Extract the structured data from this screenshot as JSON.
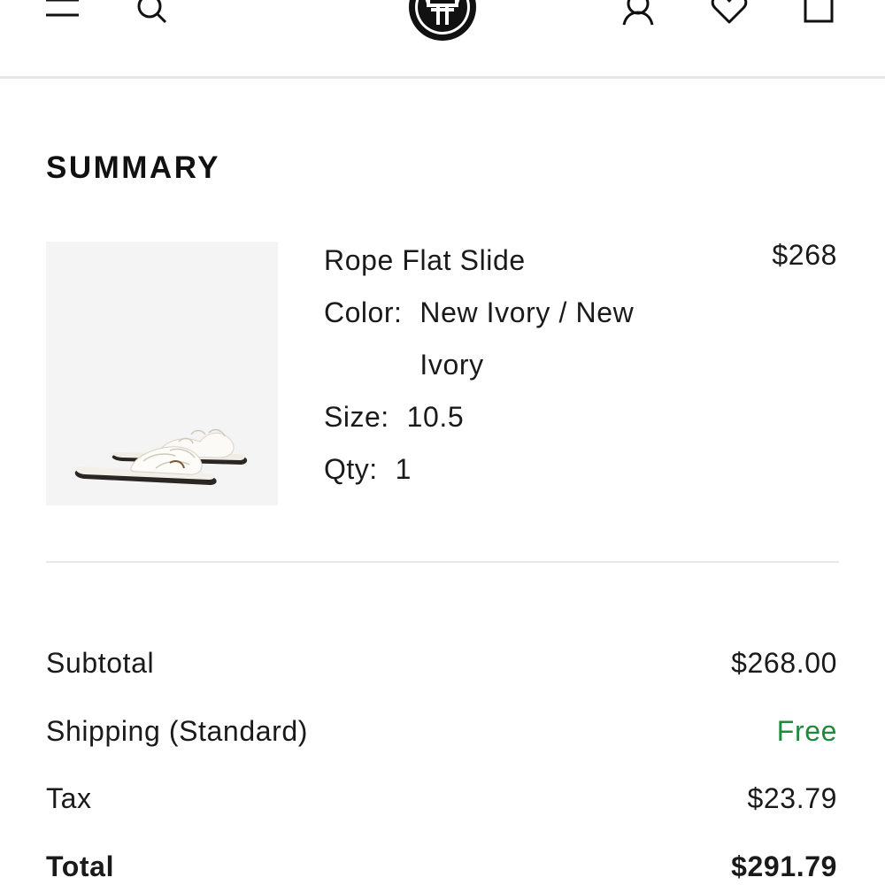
{
  "header": {
    "icons": {
      "menu": "menu-icon",
      "search": "search-icon",
      "logo": "brand-logo",
      "account": "account-icon",
      "wishlist": "heart-icon",
      "bag": "bag-icon"
    }
  },
  "summary": {
    "title": "SUMMARY",
    "item": {
      "name": "Rope Flat Slide",
      "price": "$268",
      "color_label": "Color:",
      "color_value": "New Ivory / New Ivory",
      "size_label": "Size:",
      "size_value": "10.5",
      "qty_label": "Qty:",
      "qty_value": "1"
    }
  },
  "totals": {
    "subtotal_label": "Subtotal",
    "subtotal_value": "$268.00",
    "shipping_label": "Shipping (Standard)",
    "shipping_value": "Free",
    "tax_label": "Tax",
    "tax_value": "$23.79",
    "total_label": "Total",
    "total_value": "$291.79"
  },
  "colors": {
    "text": "#111111",
    "free": "#1e8a3c",
    "divider": "#e8e9eb",
    "image_bg": "#f4f4f5"
  }
}
